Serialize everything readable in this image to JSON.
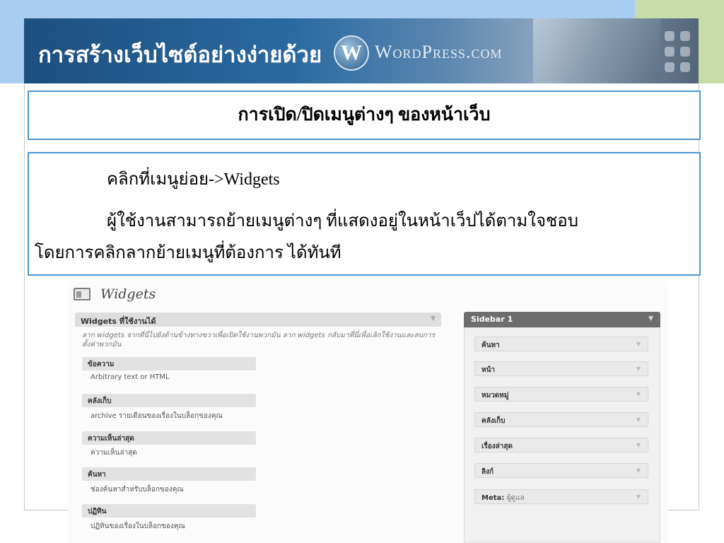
{
  "header": {
    "title": "การสร้างเว็บไซต์อย่างง่ายด้วย",
    "logo_letter": "W",
    "wordmark": "WordPress.com"
  },
  "slide": {
    "title": "การเปิด/ปิดเมนูต่างๆ ของหน้าเว็บ",
    "line1": "คลิกที่เมนูย่อย->Widgets",
    "line2": "ผู้ใช้งานสามารถย้ายเมนูต่างๆ ที่แสดงอยู่ในหน้าเว็ปได้ตามใจชอบ",
    "line3": "โดยการคลิกลากย้ายเมนูที่ต้องการ ได้ทันที"
  },
  "widgets_screen": {
    "page_title": "Widgets",
    "available": {
      "heading": "Widgets ที่ใช้งานได้",
      "description": "ลาก widgets จากที่นี่ไปยังด้านข้างทางขวาเพื่อเปิดใช้งานพวกมัน ลาก widgets กลับมาที่นี่เพื่อเลิกใช้งานและลบการตั้งค่าพวกมัน",
      "items": [
        {
          "name": "ข้อความ",
          "desc": "Arbitrary text or HTML"
        },
        {
          "name": "คลังเก็บ",
          "desc": "archive รายเดือนของเรื่องในบล็อกของคุณ"
        },
        {
          "name": "ความเห็นล่าสุด",
          "desc": "ความเห็นล่าสุด"
        },
        {
          "name": "ค้นหา",
          "desc": "ช่องค้นหาสำหรับบล็อกของคุณ"
        },
        {
          "name": "ปฏิทิน",
          "desc": "ปฏิทินของเรื่องในบล็อกของคุณ"
        }
      ]
    },
    "sidebar": {
      "heading": "Sidebar 1",
      "items": [
        {
          "name": "ค้นหา",
          "sub": ""
        },
        {
          "name": "หน้า",
          "sub": ""
        },
        {
          "name": "หมวดหมู่",
          "sub": ""
        },
        {
          "name": "คลังเก็บ",
          "sub": ""
        },
        {
          "name": "เรื่องล่าสุด",
          "sub": ""
        },
        {
          "name": "ลิงก์",
          "sub": ""
        },
        {
          "name": "Meta:",
          "sub": "ผู้ดูแล"
        }
      ]
    },
    "arrow_glyph": "▼"
  }
}
